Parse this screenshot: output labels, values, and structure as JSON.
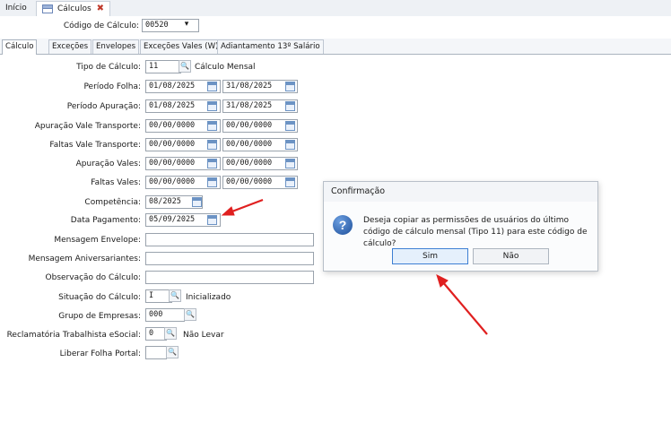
{
  "top_tabs": [
    {
      "label": "Início"
    },
    {
      "label": "Cálculos"
    }
  ],
  "header": {
    "codigo_label": "Código de Cálculo:",
    "codigo_value": "00520",
    "dropdown_glyph": "▾"
  },
  "tabs": [
    "Cálculo",
    "Exceções",
    "Envelopes",
    "Exceções Vales (W)",
    "Adiantamento 13º Salário"
  ],
  "form": {
    "tipo_calculo": {
      "label": "Tipo de Cálculo:",
      "value": "11",
      "description": "Cálculo Mensal"
    },
    "periodo_folha": {
      "label": "Período Folha:",
      "start": "01/08/2025",
      "end": "31/08/2025"
    },
    "periodo_apuracao": {
      "label": "Período Apuração:",
      "start": "01/08/2025",
      "end": "31/08/2025"
    },
    "apuracao_vt": {
      "label": "Apuração Vale Transporte:",
      "start": "00/00/0000",
      "end": "00/00/0000"
    },
    "faltas_vt": {
      "label": "Faltas Vale Transporte:",
      "start": "00/00/0000",
      "end": "00/00/0000"
    },
    "apuracao_vales": {
      "label": "Apuração Vales:",
      "start": "00/00/0000",
      "end": "00/00/0000"
    },
    "faltas_vales": {
      "label": "Faltas Vales:",
      "start": "00/00/0000",
      "end": "00/00/0000"
    },
    "competencia": {
      "label": "Competência:",
      "value": "08/2025"
    },
    "data_pagamento": {
      "label": "Data Pagamento:",
      "value": "05/09/2025"
    },
    "mensagem_envelope": {
      "label": "Mensagem Envelope:",
      "value": ""
    },
    "mensagem_aniversariantes": {
      "label": "Mensagem Aniversariantes:",
      "value": ""
    },
    "observacao": {
      "label": "Observação do Cálculo:",
      "value": ""
    },
    "situacao": {
      "label": "Situação do Cálculo:",
      "value": "I",
      "description": "Inicializado"
    },
    "grupo_empresas": {
      "label": "Grupo de Empresas:",
      "value": "000"
    },
    "reclamatoria": {
      "label": "Reclamatória Trabalhista eSocial:",
      "value": "0",
      "description": "Não Levar"
    },
    "liberar_portal": {
      "label": "Liberar Folha Portal:",
      "value": ""
    }
  },
  "dialog": {
    "title": "Confirmação",
    "message": "Deseja copiar as permissões de usuários do último código de cálculo mensal (Tipo 11) para este código de cálculo?",
    "yes": "Sim",
    "no": "Não"
  },
  "annotation_color": "#e02020"
}
